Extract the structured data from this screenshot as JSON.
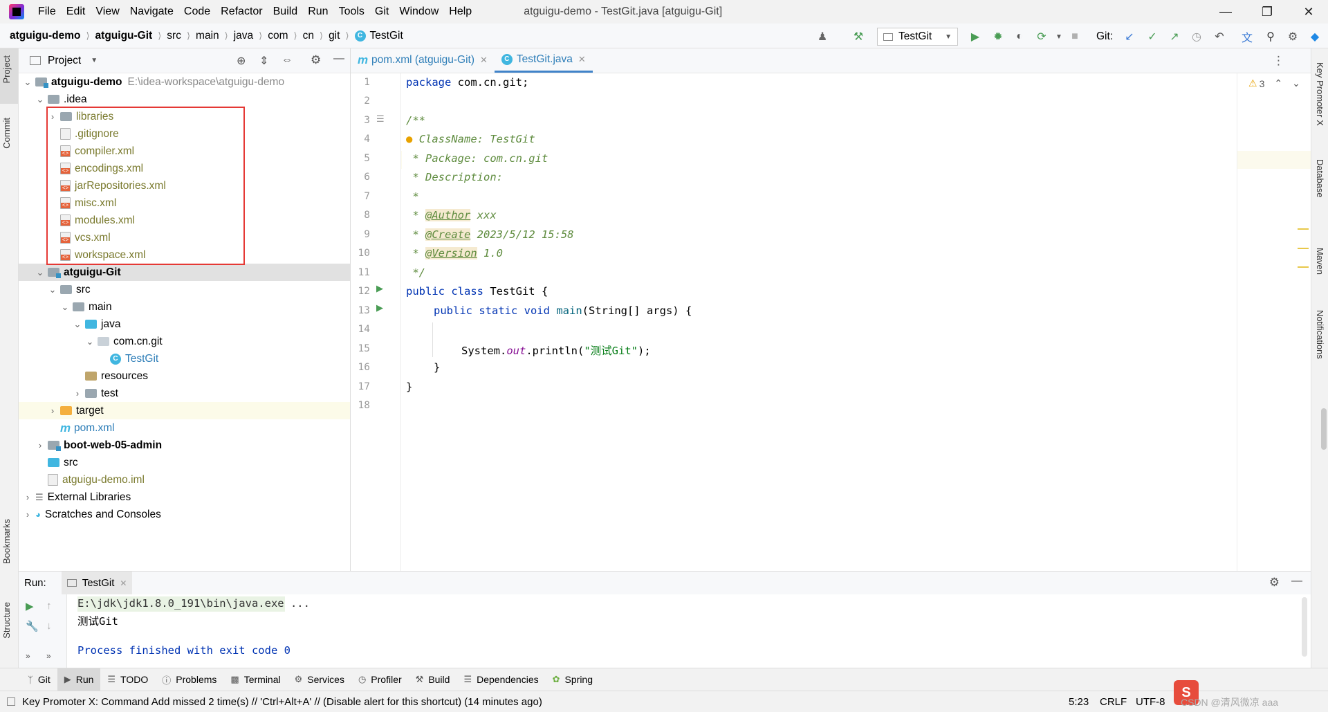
{
  "menu": [
    "File",
    "Edit",
    "View",
    "Navigate",
    "Code",
    "Refactor",
    "Build",
    "Run",
    "Tools",
    "Git",
    "Window",
    "Help"
  ],
  "window_title": "atguigu-demo - TestGit.java [atguigu-Git]",
  "breadcrumbs": [
    "atguigu-demo",
    "atguigu-Git",
    "src",
    "main",
    "java",
    "com",
    "cn",
    "git",
    "TestGit"
  ],
  "run_config": "TestGit",
  "git_label": "Git:",
  "project_panel": {
    "title": "Project",
    "tree": [
      {
        "label": "atguigu-demo",
        "path": "E:\\idea-workspace\\atguigu-demo"
      },
      {
        "label": ".idea"
      },
      {
        "label": "libraries"
      },
      {
        "label": ".gitignore"
      },
      {
        "label": "compiler.xml"
      },
      {
        "label": "encodings.xml"
      },
      {
        "label": "jarRepositories.xml"
      },
      {
        "label": "misc.xml"
      },
      {
        "label": "modules.xml"
      },
      {
        "label": "vcs.xml"
      },
      {
        "label": "workspace.xml"
      },
      {
        "label": "atguigu-Git"
      },
      {
        "label": "src"
      },
      {
        "label": "main"
      },
      {
        "label": "java"
      },
      {
        "label": "com.cn.git"
      },
      {
        "label": "TestGit"
      },
      {
        "label": "resources"
      },
      {
        "label": "test"
      },
      {
        "label": "target"
      },
      {
        "label": "pom.xml"
      },
      {
        "label": "boot-web-05-admin"
      },
      {
        "label": "src"
      },
      {
        "label": "atguigu-demo.iml"
      },
      {
        "label": "External Libraries"
      },
      {
        "label": "Scratches and Consoles"
      }
    ]
  },
  "editor": {
    "tabs": [
      {
        "label": "pom.xml (atguigu-Git)"
      },
      {
        "label": "TestGit.java"
      }
    ],
    "warnings": "3",
    "line_numbers": [
      "1",
      "2",
      "3",
      "4",
      "5",
      "6",
      "7",
      "8",
      "9",
      "10",
      "11",
      "12",
      "13",
      "14",
      "15",
      "16",
      "17",
      "18"
    ],
    "code": {
      "l1_kw": "package",
      "l1_rest": " com.cn.git;",
      "l3": "/**",
      "l4": "ClassName: TestGit",
      "l5": " * Package: com.cn.git",
      "l6": " * Description:",
      "l7": " *",
      "l8_pre": " * ",
      "l8_tag": "@Author",
      "l8_val": " xxx",
      "l9_tag": "@Create",
      "l9_val": " 2023/5/12 15:58",
      "l10_tag": "@Version",
      "l10_val": " 1.0",
      "l11": " */",
      "l12_kw": "public class",
      "l12_rest": " TestGit {",
      "l13_kw": "public static void",
      "l13_fn": "main",
      "l13_rest": "(String[] args) {",
      "l15_a": "System.",
      "l15_fld": "out",
      "l15_b": ".println(",
      "l15_str": "\"测试Git\"",
      "l15_c": ");",
      "l16": "}",
      "l17": "}"
    }
  },
  "run_panel": {
    "label": "Run:",
    "tab": "TestGit",
    "output": [
      "E:\\jdk\\jdk1.8.0_191\\bin\\java.exe ...",
      "测试Git",
      "",
      "Process finished with exit code 0"
    ]
  },
  "left_strip": [
    "Project",
    "Commit",
    "Bookmarks",
    "Structure"
  ],
  "right_strip": [
    "Key Promoter X",
    "Database",
    "Maven",
    "Notifications"
  ],
  "bottom_tools": [
    "Git",
    "Run",
    "TODO",
    "Problems",
    "Terminal",
    "Services",
    "Profiler",
    "Build",
    "Dependencies",
    "Spring"
  ],
  "status": {
    "message": "Key Promoter X: Command Add missed 2 time(s) // 'Ctrl+Alt+A' // (Disable alert for this shortcut) (14 minutes ago)",
    "position": "5:23",
    "line_sep": "CRLF",
    "encoding": "UTF-8"
  },
  "watermark": "CSDN @清风微凉 aaa",
  "colors": {
    "accent": "#4083c9",
    "highlight_box": "#e53935",
    "run_green": "#499c54"
  }
}
